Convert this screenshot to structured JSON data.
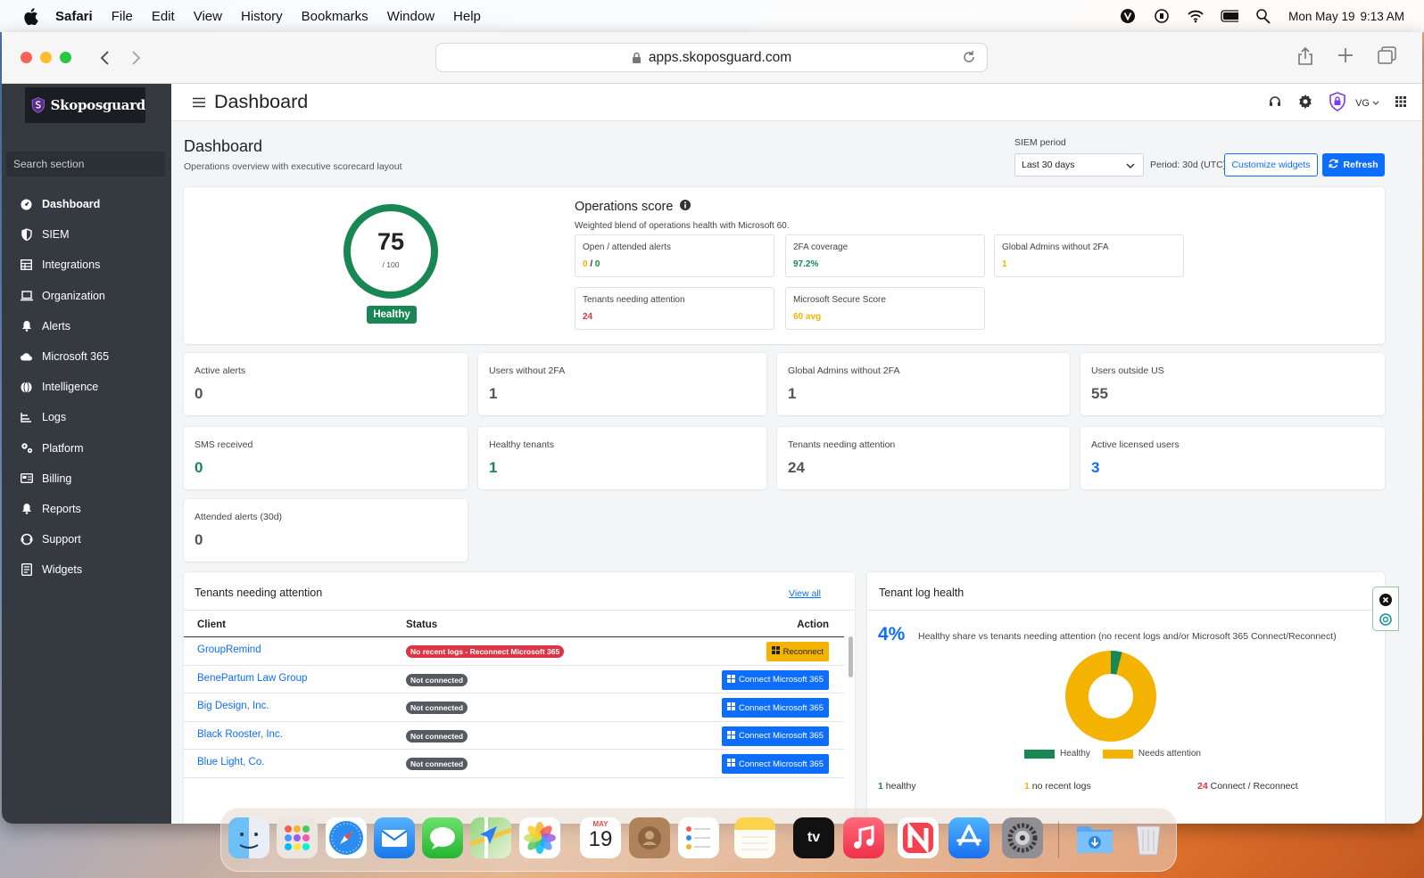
{
  "menubar": {
    "app": "Safari",
    "items": [
      "File",
      "Edit",
      "View",
      "History",
      "Bookmarks",
      "Window",
      "Help"
    ],
    "date": "Mon May 19",
    "time": "9:13 AM"
  },
  "browser": {
    "url": "apps.skoposguard.com"
  },
  "sidebar": {
    "brand": "Skoposguard",
    "search_placeholder": "Search section",
    "items": [
      {
        "label": "Dashboard",
        "icon": "dashboard-icon"
      },
      {
        "label": "SIEM",
        "icon": "shield-icon"
      },
      {
        "label": "Integrations",
        "icon": "grid-icon"
      },
      {
        "label": "Organization",
        "icon": "laptop-icon"
      },
      {
        "label": "Alerts",
        "icon": "bell-icon"
      },
      {
        "label": "Microsoft 365",
        "icon": "cloud-icon"
      },
      {
        "label": "Intelligence",
        "icon": "globe-icon"
      },
      {
        "label": "Logs",
        "icon": "logs-icon"
      },
      {
        "label": "Platform",
        "icon": "platform-icon"
      },
      {
        "label": "Billing",
        "icon": "billing-icon"
      },
      {
        "label": "Reports",
        "icon": "bell-icon"
      },
      {
        "label": "Support",
        "icon": "support-icon"
      },
      {
        "label": "Widgets",
        "icon": "widgets-icon"
      }
    ]
  },
  "header": {
    "title": "Dashboard",
    "user_initials": "VG"
  },
  "page": {
    "title": "Dashboard",
    "subtitle": "Operations overview with executive scorecard layout",
    "siem_label": "SIEM period",
    "siem_value": "Last 30 days",
    "period": "Period: 30d (UTC)",
    "customize": "Customize widgets",
    "refresh": "Refresh"
  },
  "score": {
    "value": "75",
    "denominator": "/ 100",
    "value_fraction": 0.75,
    "status": "Healthy",
    "ops_title": "Operations score",
    "ops_subtitle": "Weighted blend of operations health with Microsoft 60.",
    "minis": [
      {
        "label": "Open / attended alerts",
        "value_a": "0",
        "slash": " / ",
        "value_b": "0"
      },
      {
        "label": "2FA coverage",
        "value": "97.2%"
      },
      {
        "label": "Global Admins without 2FA",
        "value": "1"
      },
      {
        "label": "Tenants needing attention",
        "value": "24"
      },
      {
        "label": "Microsoft Secure Score",
        "value": "60 avg"
      }
    ]
  },
  "stats": [
    {
      "label": "Active alerts",
      "value": "0"
    },
    {
      "label": "Users without 2FA",
      "value": "1"
    },
    {
      "label": "Global Admins without 2FA",
      "value": "1"
    },
    {
      "label": "Users outside US",
      "value": "55"
    },
    {
      "label": "SMS received",
      "value": "0"
    },
    {
      "label": "Healthy tenants",
      "value": "1"
    },
    {
      "label": "Tenants needing attention",
      "value": "24"
    },
    {
      "label": "Active licensed users",
      "value": "3"
    },
    {
      "label": "Attended alerts (30d)",
      "value": "0"
    }
  ],
  "tenants": {
    "title": "Tenants needing attention",
    "view_all": "View all",
    "columns": [
      "Client",
      "Status",
      "Action"
    ],
    "rows": [
      {
        "client": "GroupRemind",
        "status": "No recent logs - Reconnect Microsoft 365",
        "action": "Reconnect"
      },
      {
        "client": "BenePartum Law Group",
        "status": "Not connected",
        "action": "Connect Microsoft 365"
      },
      {
        "client": "Big Design, Inc.",
        "status": "Not connected",
        "action": "Connect Microsoft 365"
      },
      {
        "client": "Black Rooster, Inc.",
        "status": "Not connected",
        "action": "Connect Microsoft 365"
      },
      {
        "client": "Blue Light, Co.",
        "status": "Not connected",
        "action": "Connect Microsoft 365"
      }
    ]
  },
  "log_health": {
    "title": "Tenant log health",
    "pct": "4%",
    "description": "Healthy share vs tenants needing attention (no recent logs and/or Microsoft 365 Connect/Reconnect)",
    "legend_healthy": "Healthy",
    "legend_attention": "Needs attention",
    "healthy_count": "1",
    "healthy_label": "healthy",
    "nologs_count": "1",
    "nologs_label": "no recent logs",
    "connect_count": "24",
    "connect_label": "Connect / Reconnect",
    "healthy_fraction": 0.04,
    "colors": {
      "healthy": "#198754",
      "attention": "#f5b301"
    }
  },
  "dock": {
    "calendar_month": "MAY",
    "calendar_day": "19",
    "tv_label": "tv"
  }
}
